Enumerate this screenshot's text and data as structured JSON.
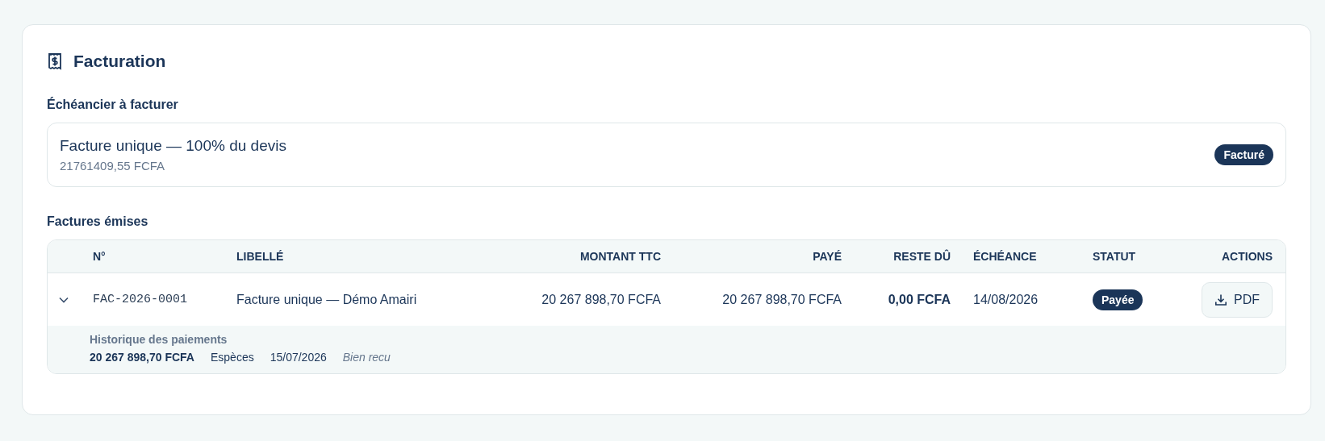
{
  "title": "Facturation",
  "schedule": {
    "heading": "Échéancier à facturer",
    "items": [
      {
        "label": "Facture unique — 100% du devis",
        "amount": "21761409,55 FCFA",
        "status": "Facturé"
      }
    ]
  },
  "invoices": {
    "heading": "Factures émises",
    "columns": [
      "N°",
      "LIBELLÉ",
      "MONTANT TTC",
      "PAYÉ",
      "RESTE DÛ",
      "ÉCHÉANCE",
      "STATUT",
      "ACTIONS"
    ],
    "rows": [
      {
        "expanded": true,
        "number": "FAC-2026-0001",
        "label": "Facture unique — Démo Amairi",
        "amount": "20 267 898,70 FCFA",
        "paid": "20 267 898,70 FCFA",
        "remaining": "0,00 FCFA",
        "due": "14/08/2026",
        "status": "Payée",
        "action": "PDF",
        "history": {
          "title": "Historique des paiements",
          "payments": [
            {
              "amount": "20 267 898,70 FCFA",
              "method": "Espèces",
              "date": "15/07/2026",
              "note": "Bien recu"
            }
          ]
        }
      }
    ]
  }
}
